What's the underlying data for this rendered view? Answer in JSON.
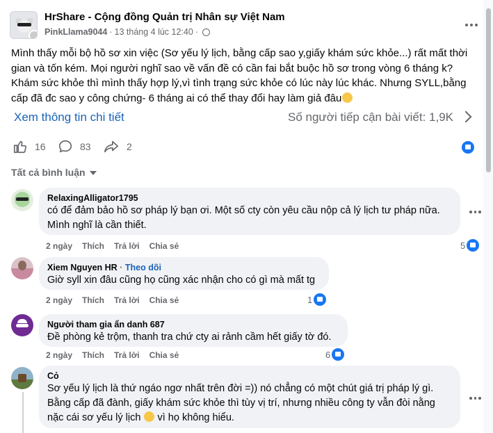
{
  "post": {
    "group_name": "HrShare - Cộng đồng Quản trị Nhân sự Việt Nam",
    "author": "PinkLlama9044",
    "separator": "·",
    "time": "13 tháng 4 lúc 12:40",
    "time_sep": "·",
    "body": "Mình thấy mỗi bộ hồ sơ xin việc (Sơ yếu lý lịch, bằng cấp sao y,giấy khám sức khỏe...) rất mất thời gian và tốn kém. Mọi người nghĩ sao về vấn đề có cần fai bắt buộc hồ sơ trong vòng 6 tháng k? Khám sức khỏe thì mình thấy hợp lý,vì tình trạng sức khỏe có lúc này lúc khác. Nhưng SYLL,bằng cấp đã đc sao y công chứng- 6 tháng ai có thể thay đổi hay làm giả đâu",
    "details_link": "Xem thông tin chi tiết",
    "reach_text": "Số người tiếp cận bài viết: 1,9K",
    "likes": "16",
    "comments": "83",
    "shares": "2",
    "filter_label": "Tất cả bình luận"
  },
  "comments": [
    {
      "author": "RelaxingAlligator1795",
      "follow": "",
      "text": "có để đảm bảo hồ sơ pháp lý bạn ơi. Một số cty còn yêu cầu nộp cả lý lịch tư pháp nữa. Mình nghĩ là cần thiết.",
      "time": "2 ngày",
      "like_label": "Thích",
      "reply_label": "Trả lời",
      "share_label": "Chia sẻ",
      "reactions": "5"
    },
    {
      "author": "Xiem Nguyen HR",
      "follow": "Theo dõi",
      "follow_sep": "·",
      "text": "Giờ syll xin đâu cũng họ cũng xác nhận cho có gì mà mất tg",
      "time": "2 ngày",
      "like_label": "Thích",
      "reply_label": "Trả lời",
      "share_label": "Chia sẻ",
      "reactions": "1"
    },
    {
      "author": "Người tham gia ẩn danh 687",
      "follow": "",
      "text": "Đề phòng kẻ trộm, thanh tra chứ cty ai rảnh cầm hết giấy tờ đó.",
      "time": "2 ngày",
      "like_label": "Thích",
      "reply_label": "Trả lời",
      "share_label": "Chia sẻ",
      "reactions": "6"
    },
    {
      "author": "Cỏ",
      "follow": "",
      "text": "Sơ yếu lý lịch là thứ ngáo ngơ nhất trên đời =)) nó chẳng có một chút giá trị pháp lý gì. Bằng cấp đã đành, giấy khám sức khỏe thì tùy vị trí, nhưng nhiều công ty vẫn đòi nằng nặc cái sơ yếu lý lịch",
      "text_tail": "vì họ không hiểu.",
      "time": "",
      "like_label": "",
      "reply_label": "",
      "share_label": "",
      "reactions": ""
    }
  ],
  "icons": {
    "like": "thumbs-up-icon",
    "comment": "comment-bubble-icon",
    "share": "share-arrow-icon",
    "globe": "globe-icon",
    "more": "more-dots-icon"
  },
  "colors": {
    "link_blue": "#1a63b8",
    "reaction_blue": "#1877f2",
    "bubble_bg": "#f0f2f5",
    "muted_text": "#65676b"
  }
}
